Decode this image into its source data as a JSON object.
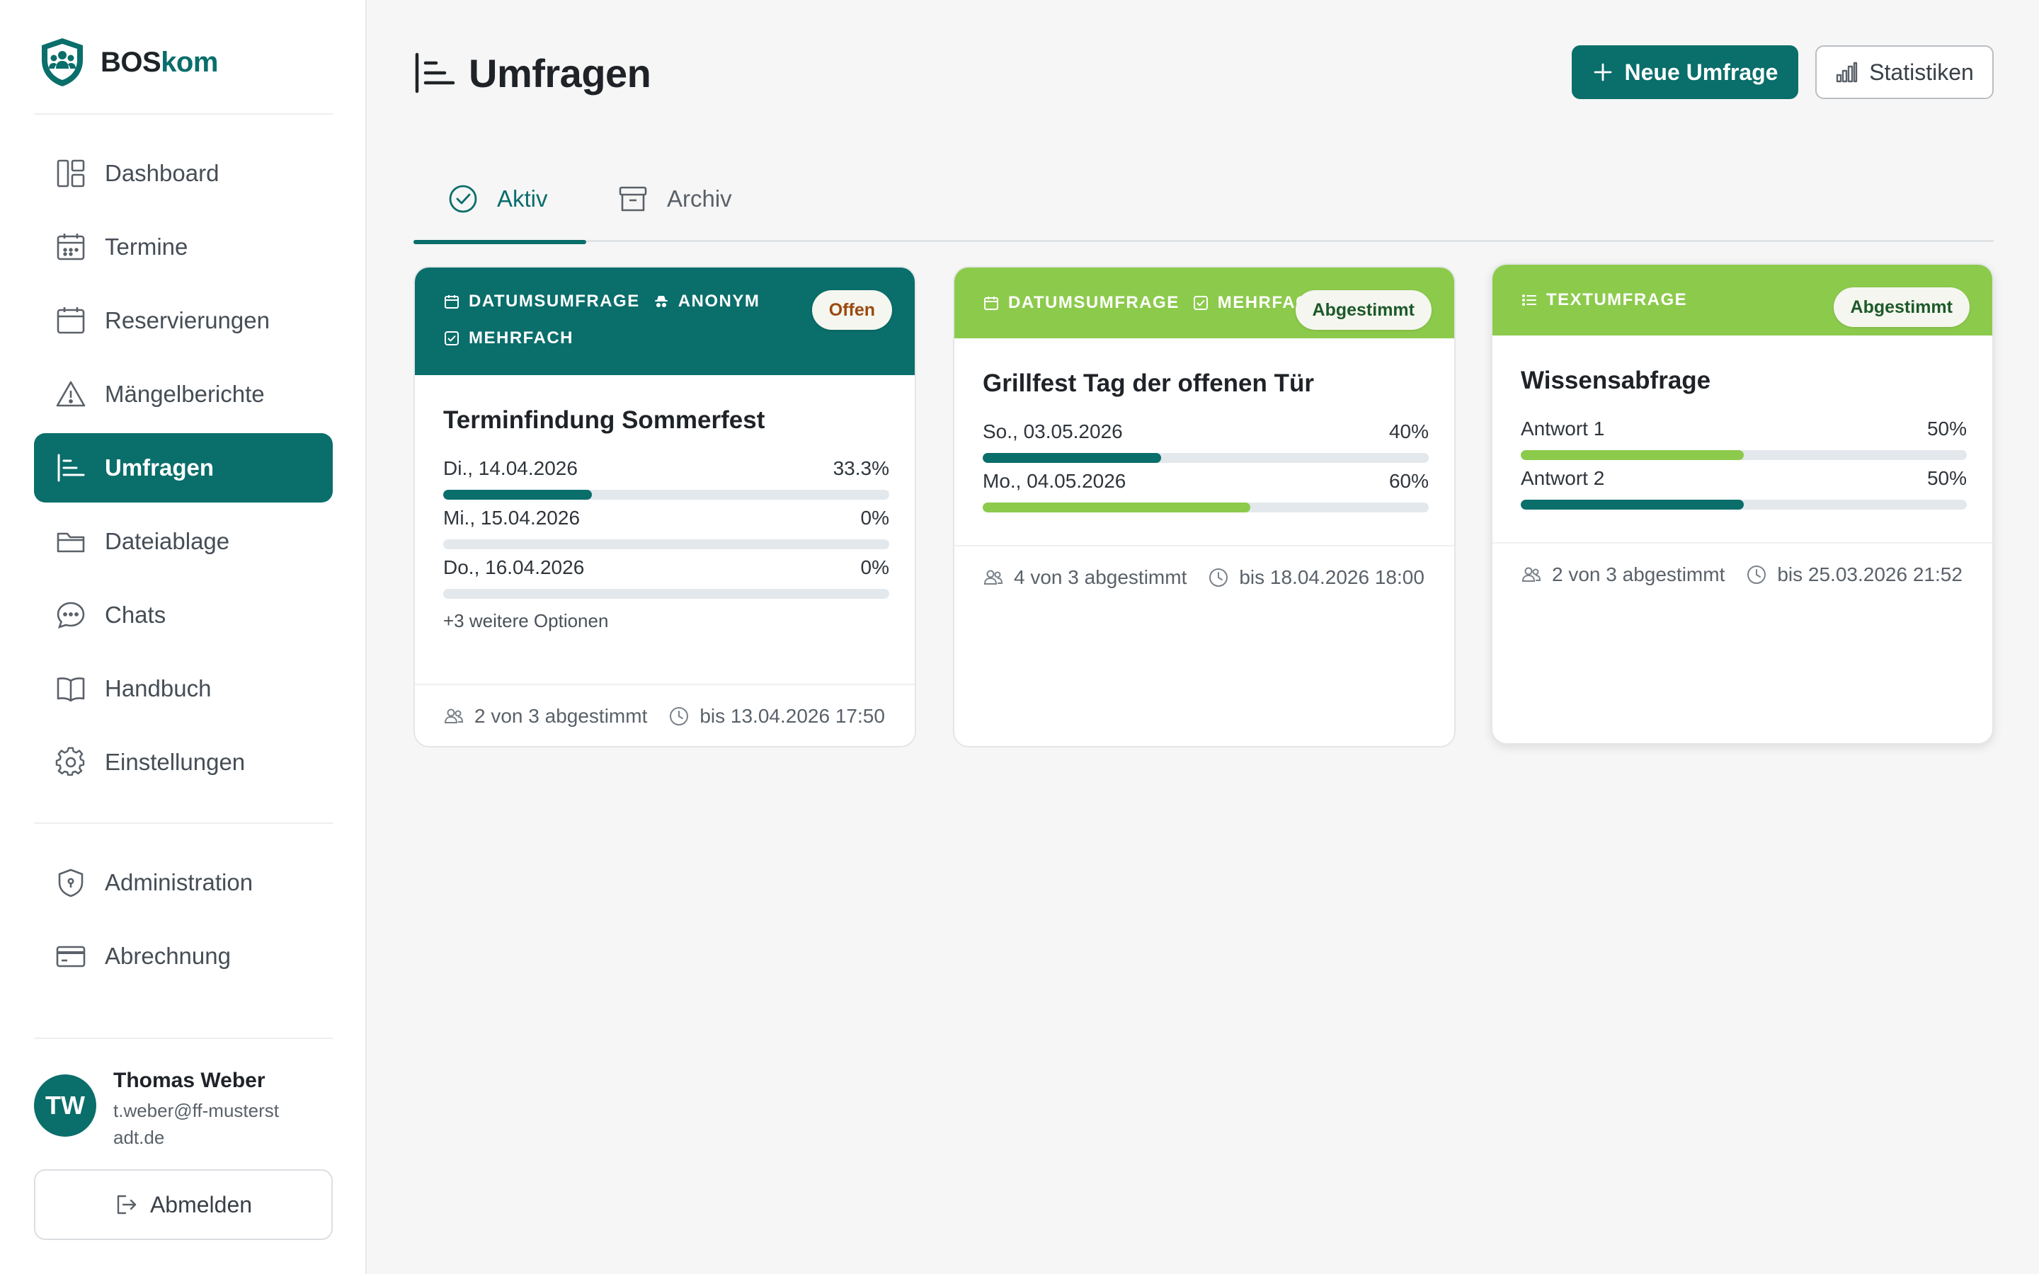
{
  "brand": {
    "name_a": "BOS",
    "name_b": "kom"
  },
  "sidebar": {
    "items": [
      {
        "label": "Dashboard"
      },
      {
        "label": "Termine"
      },
      {
        "label": "Reservierungen"
      },
      {
        "label": "Mängelberichte"
      },
      {
        "label": "Umfragen"
      },
      {
        "label": "Dateiablage"
      },
      {
        "label": "Chats"
      },
      {
        "label": "Handbuch"
      },
      {
        "label": "Einstellungen"
      }
    ],
    "admin_items": [
      {
        "label": "Administration"
      },
      {
        "label": "Abrechnung"
      }
    ],
    "active_index": 4
  },
  "user": {
    "initials": "TW",
    "name": "Thomas Weber",
    "email": "t.weber@ff-musterstadt.de",
    "logout_label": "Abmelden"
  },
  "header": {
    "title": "Umfragen",
    "new_button": "Neue Umfrage",
    "stats_button": "Statistiken"
  },
  "tabs": [
    {
      "label": "Aktiv",
      "active": true
    },
    {
      "label": "Archiv",
      "active": false
    }
  ],
  "colors": {
    "primary": "#0a6e6b",
    "accent_green": "#8cca4c",
    "badge_open_text": "#9a4a10",
    "badge_voted_text": "#1d5a2a"
  },
  "cards": [
    {
      "tags": [
        "DATUMSUMFRAGE",
        "ANONYM",
        "MEHRFACH"
      ],
      "badge": "Offen",
      "title": "Terminfindung Sommerfest",
      "options": [
        {
          "label": "Di., 14.04.2026",
          "percent": "33.3%",
          "value": 33.3
        },
        {
          "label": "Mi., 15.04.2026",
          "percent": "0%",
          "value": 0
        },
        {
          "label": "Do., 16.04.2026",
          "percent": "0%",
          "value": 0
        }
      ],
      "more": "+3 weitere Optionen",
      "votes": "2 von 3 abgestimmt",
      "deadline": "bis 13.04.2026 17:50"
    },
    {
      "tags": [
        "DATUMSUMFRAGE",
        "MEHRFAC"
      ],
      "badge": "Abgestimmt",
      "title": "Grillfest Tag der offenen Tür",
      "options": [
        {
          "label": "So., 03.05.2026",
          "percent": "40%",
          "value": 40
        },
        {
          "label": "Mo., 04.05.2026",
          "percent": "60%",
          "value": 60
        }
      ],
      "votes": "4 von 3 abgestimmt",
      "deadline": "bis 18.04.2026 18:00"
    },
    {
      "tags": [
        "TEXTUMFRAGE"
      ],
      "badge": "Abgestimmt",
      "title": "Wissensabfrage",
      "options": [
        {
          "label": "Antwort 1",
          "percent": "50%",
          "value": 50
        },
        {
          "label": "Antwort 2",
          "percent": "50%",
          "value": 50
        }
      ],
      "votes": "2 von 3 abgestimmt",
      "deadline": "bis 25.03.2026 21:52"
    }
  ]
}
